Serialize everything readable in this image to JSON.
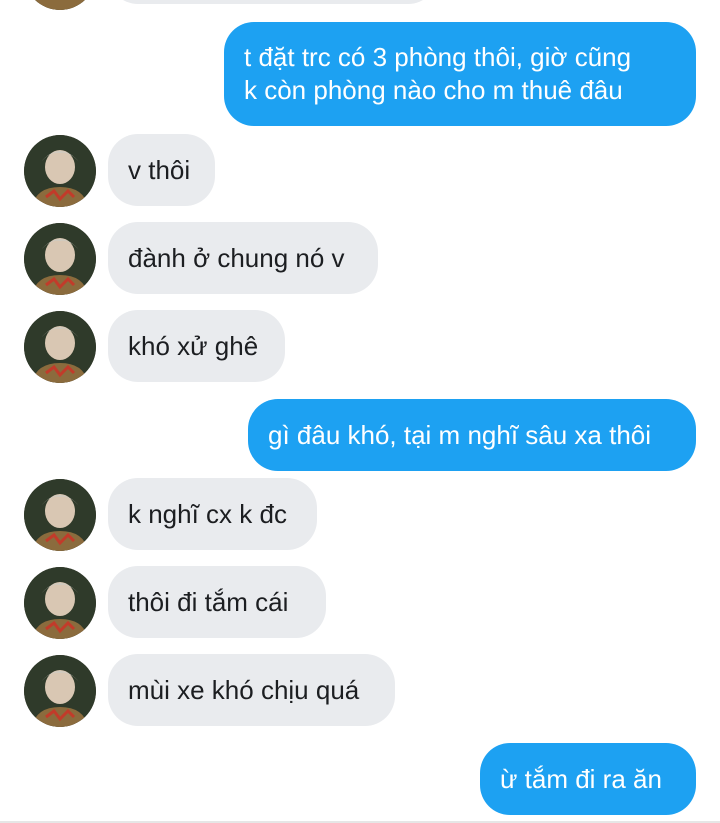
{
  "messages": [
    {
      "side": "in",
      "text": ""
    },
    {
      "side": "out",
      "text": "t đặt trc có 3 phòng thôi, giờ cũng\nk còn phòng nào cho m thuê đâu"
    },
    {
      "side": "in",
      "text": "v thôi"
    },
    {
      "side": "in",
      "text": "đành ở chung nó v"
    },
    {
      "side": "in",
      "text": "khó xử ghê"
    },
    {
      "side": "out",
      "text": "gì đâu khó, tại m nghĩ sâu xa thôi"
    },
    {
      "side": "in",
      "text": "k nghĩ cx k đc"
    },
    {
      "side": "in",
      "text": "thôi đi tắm cái"
    },
    {
      "side": "in",
      "text": "mùi xe khó chịu quá"
    },
    {
      "side": "out",
      "text": "ừ tắm đi ra ăn"
    }
  ],
  "colors": {
    "outgoing_bubble": "#1da1f2",
    "incoming_bubble": "#e9ebee",
    "background": "#ffffff"
  },
  "icons": {
    "avatar": "contact-avatar-photo"
  }
}
